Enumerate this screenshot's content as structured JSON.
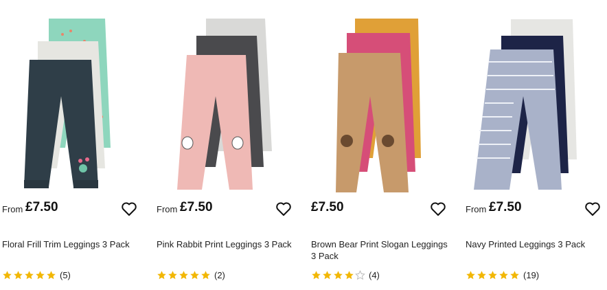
{
  "accent": "#f2b705",
  "products": [
    {
      "from_label": "From",
      "price": "£7.50",
      "title": "Floral Frill Trim Leggings 3 Pack",
      "rating": 5,
      "review_count": "(5)",
      "image": "floral-leggings"
    },
    {
      "from_label": "From",
      "price": "£7.50",
      "title": "Pink Rabbit Print Leggings 3 Pack",
      "rating": 5,
      "review_count": "(2)",
      "image": "rabbit-leggings"
    },
    {
      "from_label": "",
      "price": "£7.50",
      "title": "Brown Bear Print Slogan Leggings 3 Pack",
      "rating": 4,
      "review_count": "(4)",
      "image": "bear-leggings"
    },
    {
      "from_label": "From",
      "price": "£7.50",
      "title": "Navy Printed Leggings 3 Pack",
      "rating": 5,
      "review_count": "(19)",
      "image": "navy-leggings"
    }
  ]
}
